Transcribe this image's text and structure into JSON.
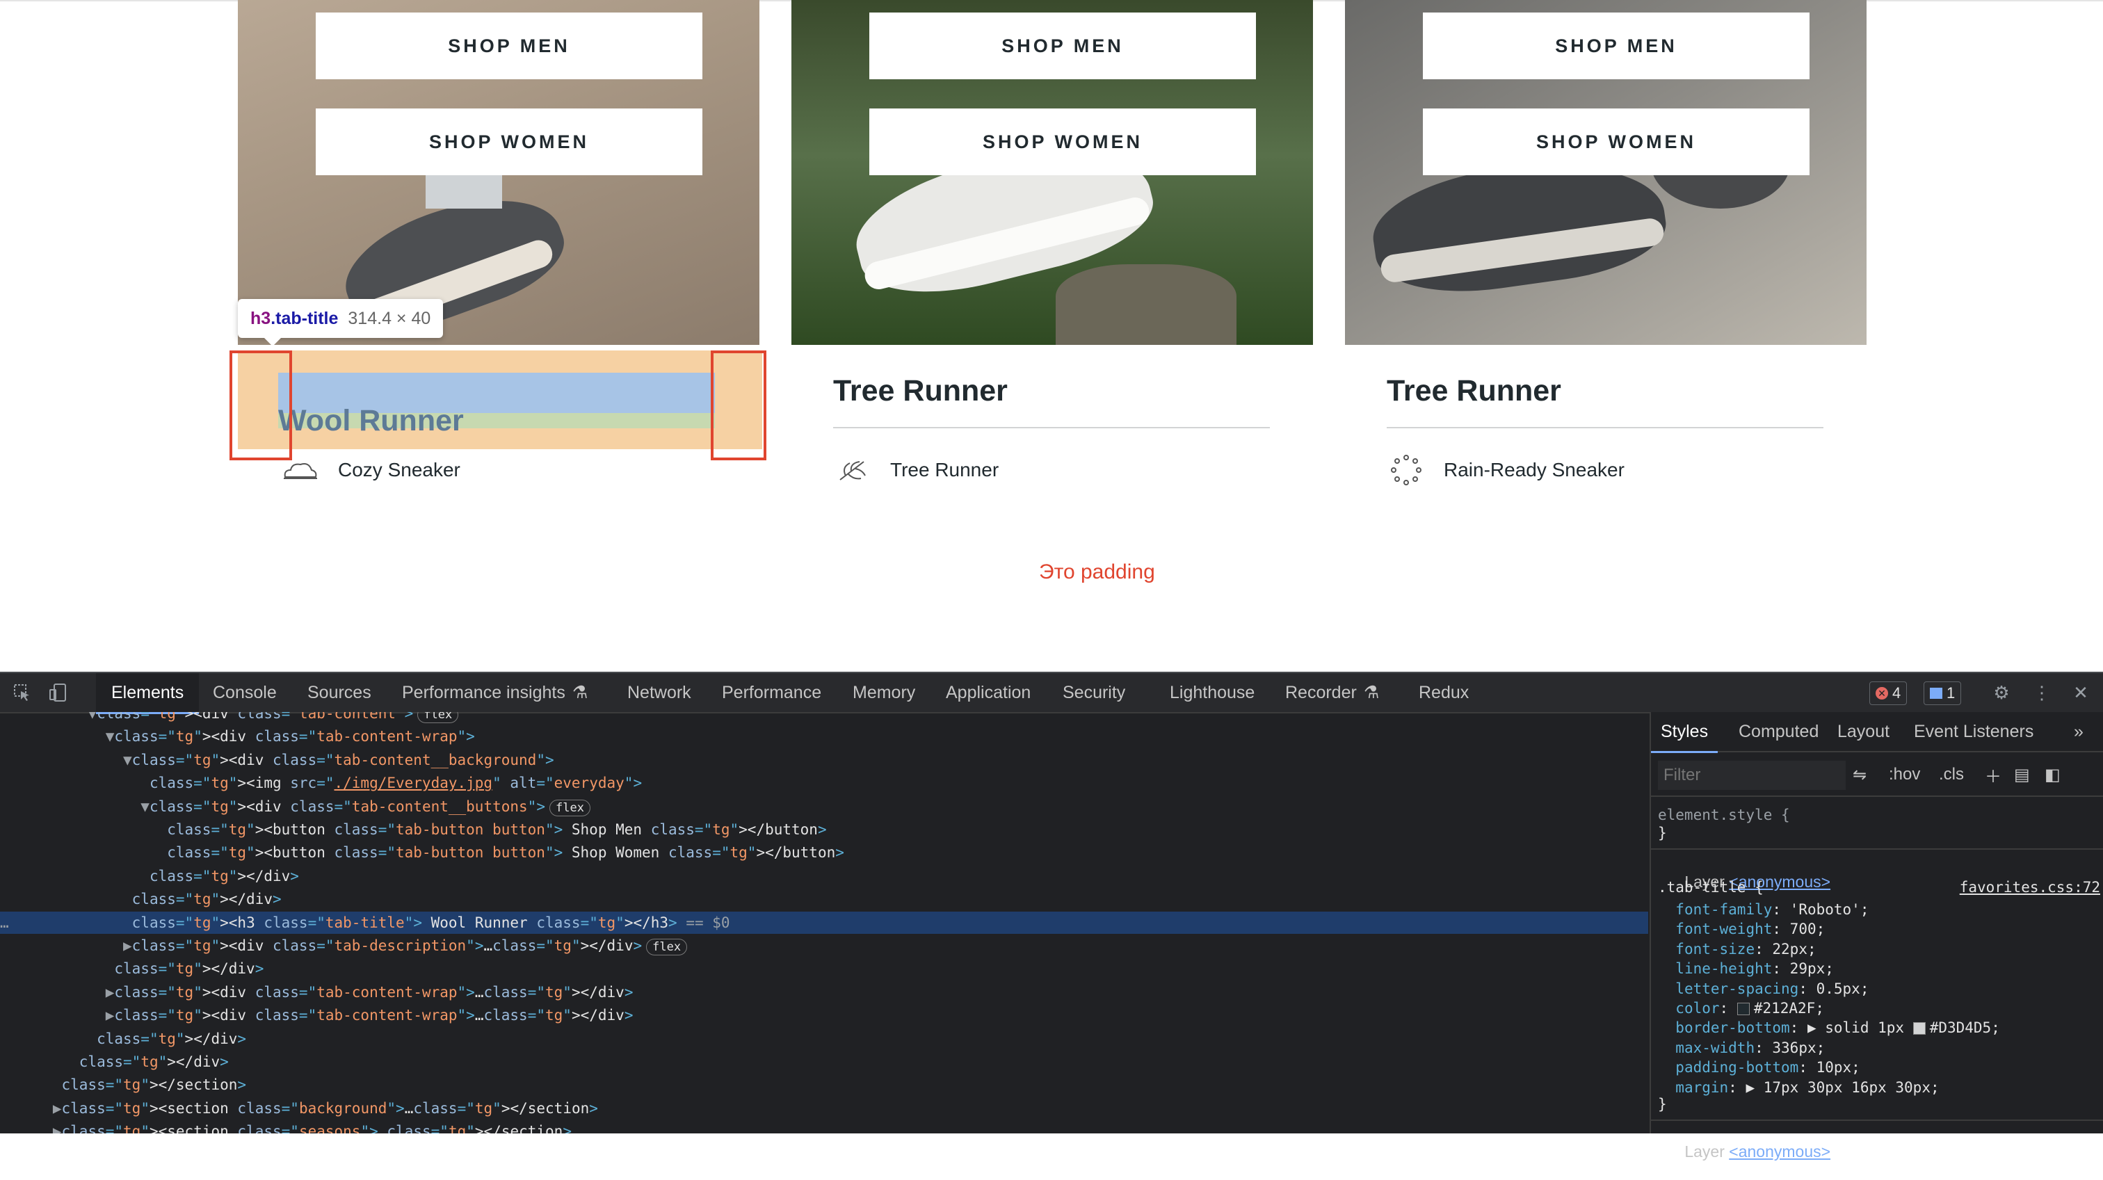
{
  "cards": [
    {
      "shop_men": "SHOP MEN",
      "shop_women": "SHOP WOMEN",
      "title": "Wool Runner",
      "description": "Cozy Sneaker",
      "icon": "cloud-icon"
    },
    {
      "shop_men": "SHOP MEN",
      "shop_women": "SHOP WOMEN",
      "title": "Tree Runner",
      "description": "Tree Runner",
      "icon": "leaf-icon"
    },
    {
      "shop_men": "SHOP MEN",
      "shop_women": "SHOP WOMEN",
      "title": "Tree Runner",
      "description": "Rain-Ready Sneaker",
      "icon": "rain-icon"
    }
  ],
  "inspect_tooltip": {
    "selector": "h3",
    "class_name": ".tab-title",
    "dimensions": "314.4 × 40"
  },
  "padding_note": "Это padding",
  "devtools": {
    "tabs": [
      "Elements",
      "Console",
      "Sources",
      "Performance insights",
      "Network",
      "Performance",
      "Memory",
      "Application",
      "Security",
      "Lighthouse",
      "Recorder",
      "Redux"
    ],
    "active_tab": "Elements",
    "error_count": "4",
    "message_count": "1",
    "dom_lines": [
      {
        "indent": 3,
        "tri": "▼",
        "html": "<div class=\"tab-content\">",
        "pill": "flex"
      },
      {
        "indent": 4,
        "tri": "▼",
        "html": "<div class=\"tab-content-wrap\">"
      },
      {
        "indent": 5,
        "tri": "▼",
        "html": "<div class=\"tab-content__background\">"
      },
      {
        "indent": 6,
        "tri": "",
        "html": "<img src=\"./img/Everyday.jpg\" alt=\"everyday\">"
      },
      {
        "indent": 6,
        "tri": "▼",
        "html": "<div class=\"tab-content__buttons\">",
        "pill": "flex"
      },
      {
        "indent": 7,
        "tri": "",
        "html": "<button class=\"tab-button button\"> Shop Men </button>"
      },
      {
        "indent": 7,
        "tri": "",
        "html": "<button class=\"tab-button button\"> Shop Women </button>"
      },
      {
        "indent": 6,
        "tri": "",
        "html": "</div>"
      },
      {
        "indent": 5,
        "tri": "",
        "html": "</div>"
      },
      {
        "indent": 5,
        "tri": "",
        "html": "<h3 class=\"tab-title\"> Wool Runner </h3> == $0",
        "selected": true
      },
      {
        "indent": 5,
        "tri": "▶",
        "html": "<div class=\"tab-description\">…</div>",
        "pill": "flex"
      },
      {
        "indent": 4,
        "tri": "",
        "html": "</div>"
      },
      {
        "indent": 4,
        "tri": "▶",
        "html": "<div class=\"tab-content-wrap\">…</div>"
      },
      {
        "indent": 4,
        "tri": "▶",
        "html": "<div class=\"tab-content-wrap\">…</div>"
      },
      {
        "indent": 3,
        "tri": "",
        "html": "</div>"
      },
      {
        "indent": 2,
        "tri": "",
        "html": "</div>"
      },
      {
        "indent": 1,
        "tri": "",
        "html": "</section>"
      },
      {
        "indent": 1,
        "tri": "▶",
        "html": "<section class=\"background\">…</section>"
      },
      {
        "indent": 1,
        "tri": "▶",
        "html": "<section class=\"seasons\">…</section>"
      }
    ],
    "styles_panel": {
      "tabs": [
        "Styles",
        "Computed",
        "Layout",
        "Event Listeners"
      ],
      "filter_placeholder": "Filter",
      "hov": ":hov",
      "cls": ".cls",
      "element_style": "element.style {",
      "close_brace": "}",
      "layer_label": "Layer",
      "layer_link": "<anonymous>",
      "rule_selector": ".tab-title {",
      "rule_source": "favorites.css:72",
      "declarations": [
        {
          "prop": "font-family",
          "value": "'Roboto';"
        },
        {
          "prop": "font-weight",
          "value": "700;"
        },
        {
          "prop": "font-size",
          "value": "22px;"
        },
        {
          "prop": "line-height",
          "value": "29px;"
        },
        {
          "prop": "letter-spacing",
          "value": "0.5px;"
        },
        {
          "prop": "color",
          "value": "#212A2F;",
          "swatch": "#212A2F"
        },
        {
          "prop": "border-bottom",
          "value": "▶ solid 1px #D3D4D5;",
          "swatch": "#D3D4D5"
        },
        {
          "prop": "max-width",
          "value": "336px;"
        },
        {
          "prop": "padding-bottom",
          "value": "10px;"
        },
        {
          "prop": "margin",
          "value": "▶ 17px 30px 16px 30px;"
        }
      ]
    }
  }
}
